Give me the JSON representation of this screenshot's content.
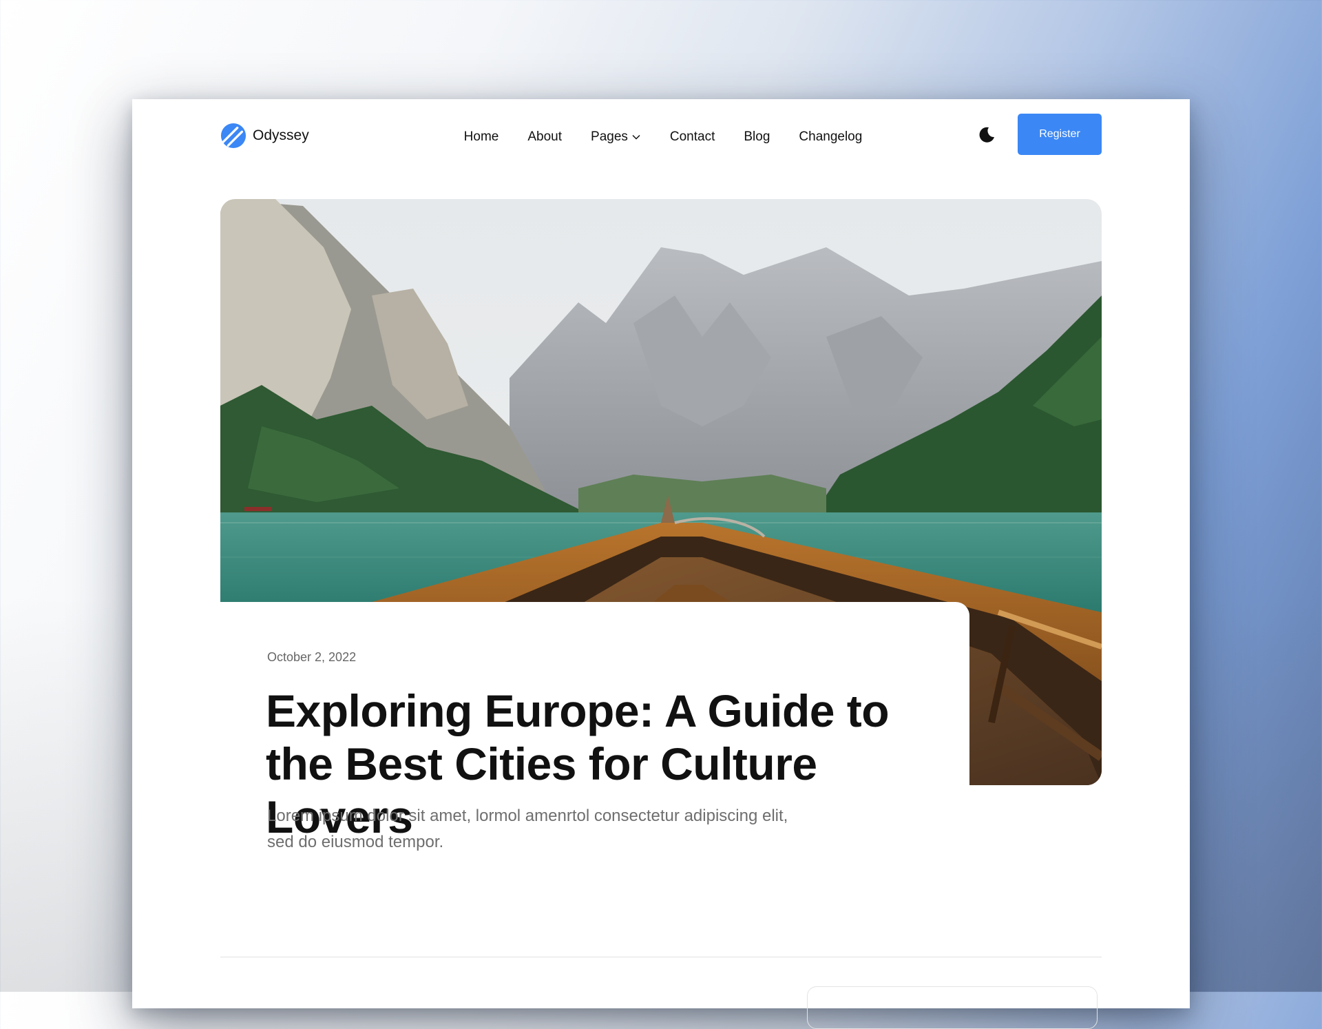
{
  "brand": {
    "name": "Odyssey",
    "accent": "#3b87f5"
  },
  "nav": {
    "items": [
      {
        "label": "Home"
      },
      {
        "label": "About"
      },
      {
        "label": "Pages"
      },
      {
        "label": "Contact"
      },
      {
        "label": "Blog"
      },
      {
        "label": "Changelog"
      }
    ]
  },
  "header": {
    "theme_icon": "moon-icon",
    "register_label": "Register"
  },
  "post": {
    "date": "October 2, 2022",
    "title": "Exploring Europe: A Guide to the Best Cities for Culture Lovers",
    "excerpt": "Lorem ipsum dolor sit amet, lormol amenrtol consectetur adipiscing elit, sed do eiusmod tempor."
  }
}
